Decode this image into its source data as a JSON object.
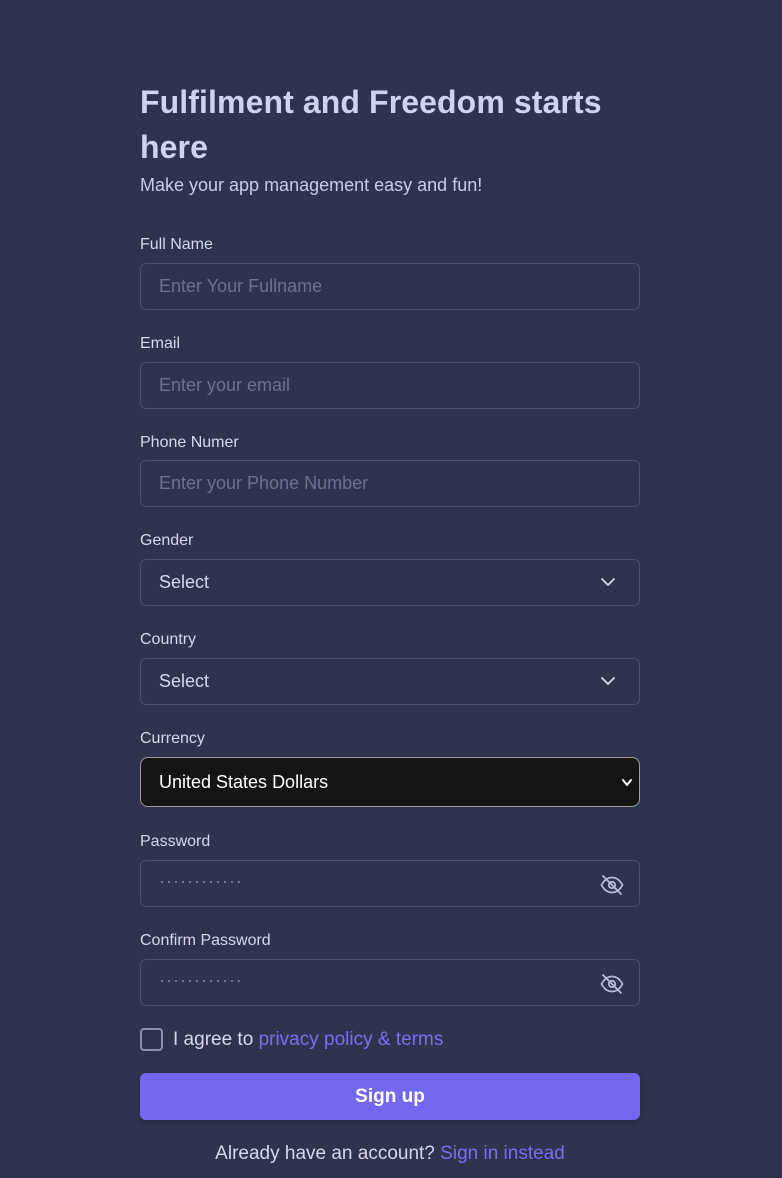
{
  "header": {
    "title": "Fulfilment and Freedom starts here",
    "subtitle": "Make your app management easy and fun!"
  },
  "form": {
    "full_name": {
      "label": "Full Name",
      "placeholder": "Enter Your Fullname"
    },
    "email": {
      "label": "Email",
      "placeholder": "Enter your email"
    },
    "phone": {
      "label": "Phone Numer",
      "placeholder": "Enter your Phone Number"
    },
    "gender": {
      "label": "Gender",
      "value": "Select"
    },
    "country": {
      "label": "Country",
      "value": "Select"
    },
    "currency": {
      "label": "Currency",
      "value": "United States Dollars"
    },
    "password": {
      "label": "Password",
      "placeholder": "············"
    },
    "confirm_password": {
      "label": "Confirm Password",
      "placeholder": "············"
    }
  },
  "agree": {
    "prefix": "I agree to",
    "link": "privacy policy & terms",
    "checked": false
  },
  "signup_button": "Sign up",
  "signin": {
    "prompt": "Already have an account?",
    "link": "Sign in instead"
  },
  "colors": {
    "background": "#30334e",
    "primary": "#7367f0",
    "link": "#7a6df4"
  },
  "icons": {
    "select_chevron": "chevron-down-icon",
    "password_toggle": "eye-off-icon"
  }
}
